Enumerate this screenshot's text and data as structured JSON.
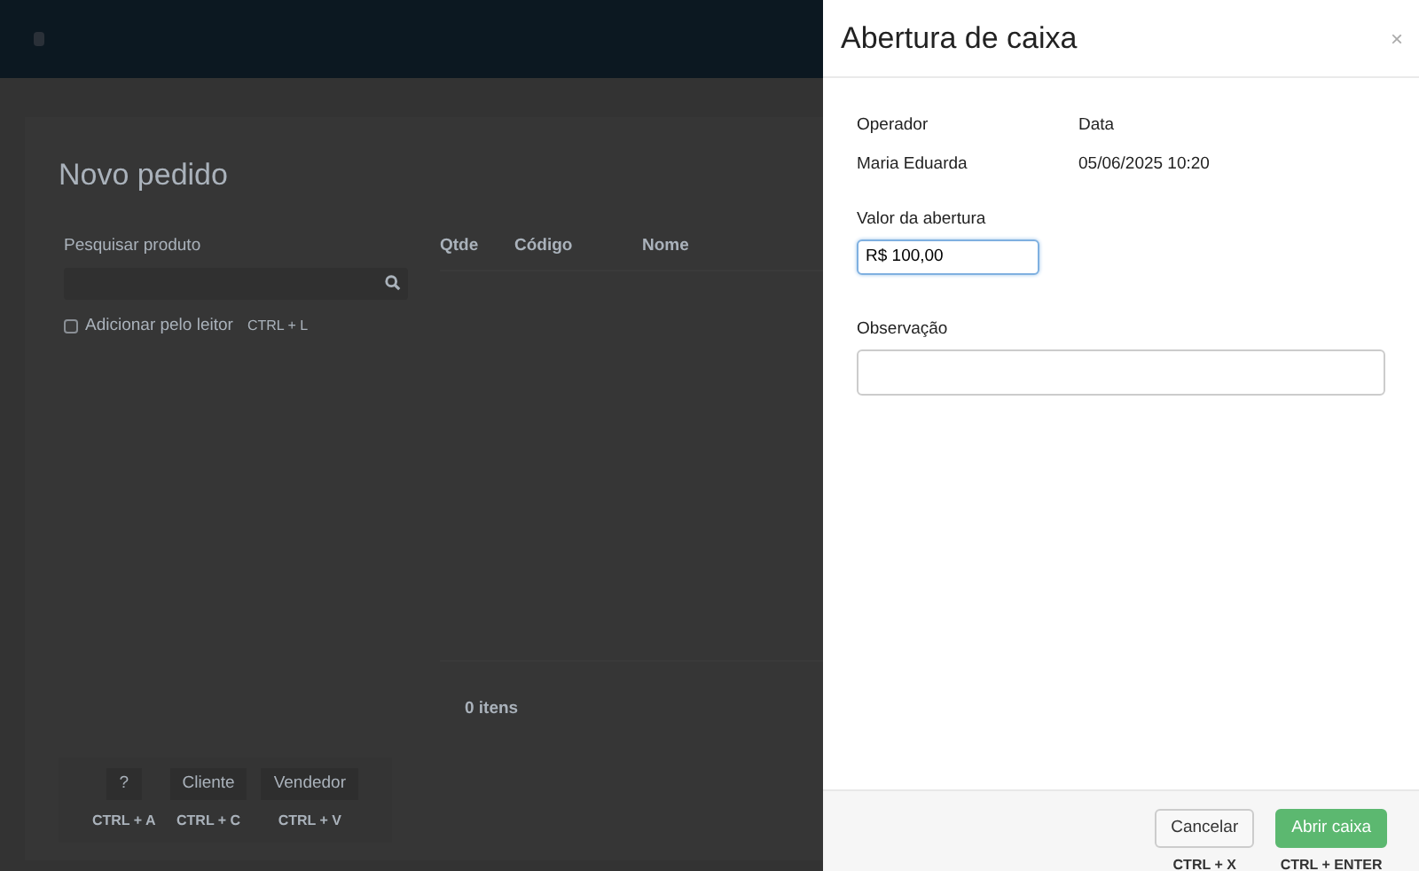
{
  "background_page": {
    "title": "Novo pedido",
    "search": {
      "label": "Pesquisar produto"
    },
    "reader_option": {
      "label": "Adicionar pelo leitor",
      "shortcut": "CTRL + L",
      "checked": false
    },
    "table": {
      "columns": [
        "Qtde",
        "Código",
        "Nome"
      ]
    },
    "item_count": "0 itens",
    "shortcuts": [
      {
        "label": "?",
        "keys": "CTRL + A"
      },
      {
        "label": "Cliente",
        "keys": "CTRL + C"
      },
      {
        "label": "Vendedor",
        "keys": "CTRL + V"
      }
    ]
  },
  "panel": {
    "title": "Abertura de caixa",
    "close": "×",
    "fields": [
      {
        "label": "Operador",
        "value": "Maria Eduarda"
      },
      {
        "label": "Data",
        "value": "05/06/2025 10:20"
      }
    ],
    "opening_value": {
      "label": "Valor da abertura",
      "value": "R$ 100,00",
      "focused": true
    },
    "note": {
      "label": "Observação"
    },
    "buttons": [
      {
        "label": "Cancelar",
        "shortcut": "CTRL + X",
        "kind": "secondary"
      },
      {
        "label": "Abrir caixa",
        "shortcut": "CTRL + ENTER",
        "kind": "primary"
      }
    ]
  }
}
